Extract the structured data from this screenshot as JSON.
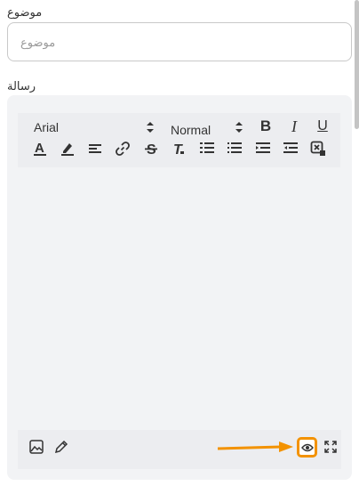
{
  "form": {
    "subject_label": "موضوع",
    "subject_placeholder": "موضوع",
    "subject_value": "",
    "message_label": "رسالة"
  },
  "toolbar": {
    "font_family": "Arial",
    "font_size": "Normal",
    "bold": "B",
    "italic": "I",
    "underline": "U",
    "text_color": "A"
  },
  "colors": {
    "editor_bg": "#f2f3f5",
    "toolbar_bg": "#ecedf0",
    "annotation": "#f39200"
  },
  "icons": {
    "toolbar": [
      "text-color-icon",
      "highlight-icon",
      "align-icon",
      "link-icon",
      "strikethrough-icon",
      "clear-format-icon",
      "ordered-list-icon",
      "bullet-list-icon",
      "indent-icon",
      "outdent-icon",
      "clean-icon"
    ],
    "footer": [
      "image-icon",
      "pencil-icon",
      "eye-icon",
      "fullscreen-icon"
    ]
  }
}
